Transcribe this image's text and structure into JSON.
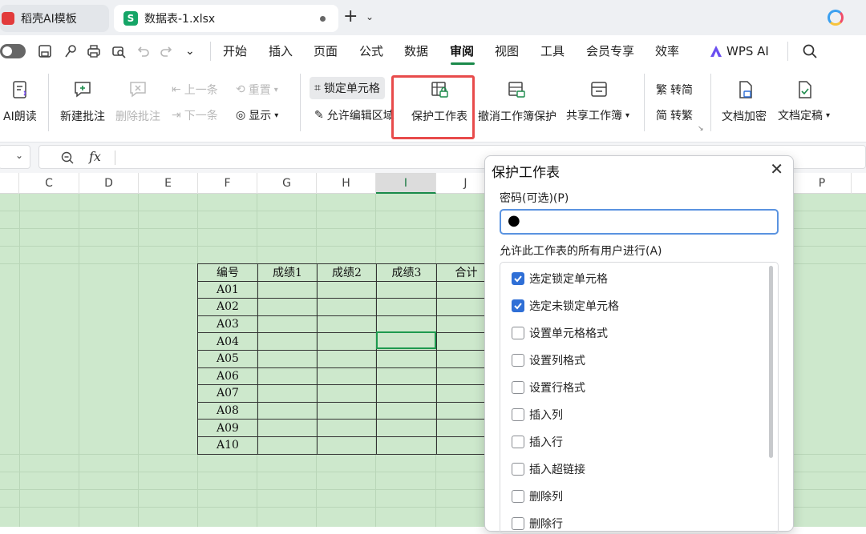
{
  "tabs": {
    "tab1_label": "稻壳AI模板",
    "tab2_label": "数据表-1.xlsx",
    "tab2_logo": "S",
    "new_tab": "+"
  },
  "menu": {
    "items": [
      "开始",
      "插入",
      "页面",
      "公式",
      "数据",
      "审阅",
      "视图",
      "工具",
      "会员专享",
      "效率"
    ],
    "active": "审阅",
    "wps_ai": "WPS AI"
  },
  "ribbon": {
    "ai_read": "AI朗读",
    "new_comment": "新建批注",
    "delete_comment": "删除批注",
    "prev": "上一条",
    "next": "下一条",
    "reset": "重置",
    "show": "显示",
    "lock_cell": "锁定单元格",
    "allow_edit": "允许编辑区域",
    "protect_sheet": "保护工作表",
    "unprotect_book": "撤消工作簿保护",
    "share_book": "共享工作簿",
    "to_simplified": "转简",
    "to_traditional": "转繁",
    "doc_encrypt": "文档加密",
    "doc_finalize": "文档定稿"
  },
  "formula": {
    "fx": "fx"
  },
  "columns": [
    "C",
    "D",
    "E",
    "F",
    "G",
    "H",
    "I",
    "J",
    "P"
  ],
  "selected_column": "I",
  "table": {
    "headers": [
      "编号",
      "成绩1",
      "成绩2",
      "成绩3",
      "合计"
    ],
    "ids": [
      "A01",
      "A02",
      "A03",
      "A04",
      "A05",
      "A06",
      "A07",
      "A08",
      "A09",
      "A10"
    ]
  },
  "dialog": {
    "title": "保护工作表",
    "password_label": "密码(可选)(P)",
    "password_value": "●",
    "allow_label": "允许此工作表的所有用户进行(A)",
    "permissions": [
      {
        "label": "选定锁定单元格",
        "checked": true
      },
      {
        "label": "选定未锁定单元格",
        "checked": true
      },
      {
        "label": "设置单元格格式",
        "checked": false
      },
      {
        "label": "设置列格式",
        "checked": false
      },
      {
        "label": "设置行格式",
        "checked": false
      },
      {
        "label": "插入列",
        "checked": false
      },
      {
        "label": "插入行",
        "checked": false
      },
      {
        "label": "插入超链接",
        "checked": false
      },
      {
        "label": "删除列",
        "checked": false
      },
      {
        "label": "删除行",
        "checked": false
      }
    ]
  },
  "colors": {
    "accent_green": "#1a8a4a",
    "sheet_bg": "#cde8cc",
    "highlight_red": "#e84b4b",
    "checkbox_blue": "#2f6fd6"
  }
}
